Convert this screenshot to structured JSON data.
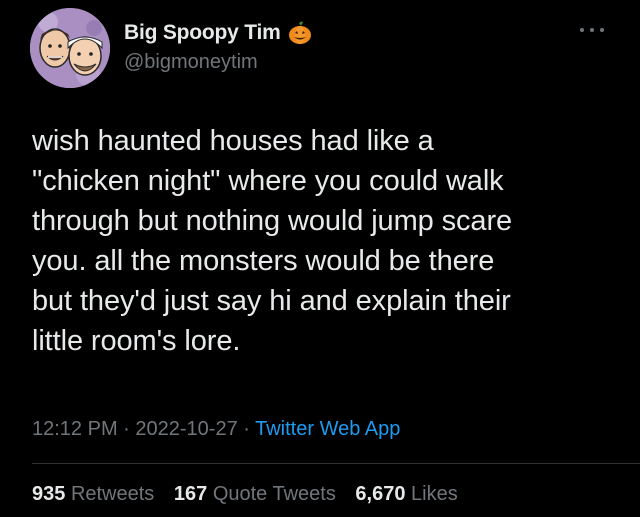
{
  "author": {
    "display_name": "Big Spoopy Tim",
    "handle": "@bigmoneytim",
    "name_emoji": "pumpkin-icon"
  },
  "tweet": {
    "text": "wish haunted houses had like a\n\"chicken night\" where you could walk\nthrough but nothing would jump scare\nyou. all the monsters would be there\nbut they'd just say hi and explain their\nlittle room's lore."
  },
  "meta": {
    "time": "12:12 PM",
    "sep1": " · ",
    "date": "2022-10-27",
    "sep2": " · ",
    "source": "Twitter Web App"
  },
  "stats": {
    "retweets_count": "935",
    "retweets_label": "Retweets",
    "quotes_count": "167",
    "quotes_label": "Quote Tweets",
    "likes_count": "6,670",
    "likes_label": "Likes"
  },
  "colors": {
    "background": "#000000",
    "text": "#e7e9ea",
    "secondary": "#71767b",
    "link": "#1d9bf0",
    "divider": "#2f3336"
  }
}
